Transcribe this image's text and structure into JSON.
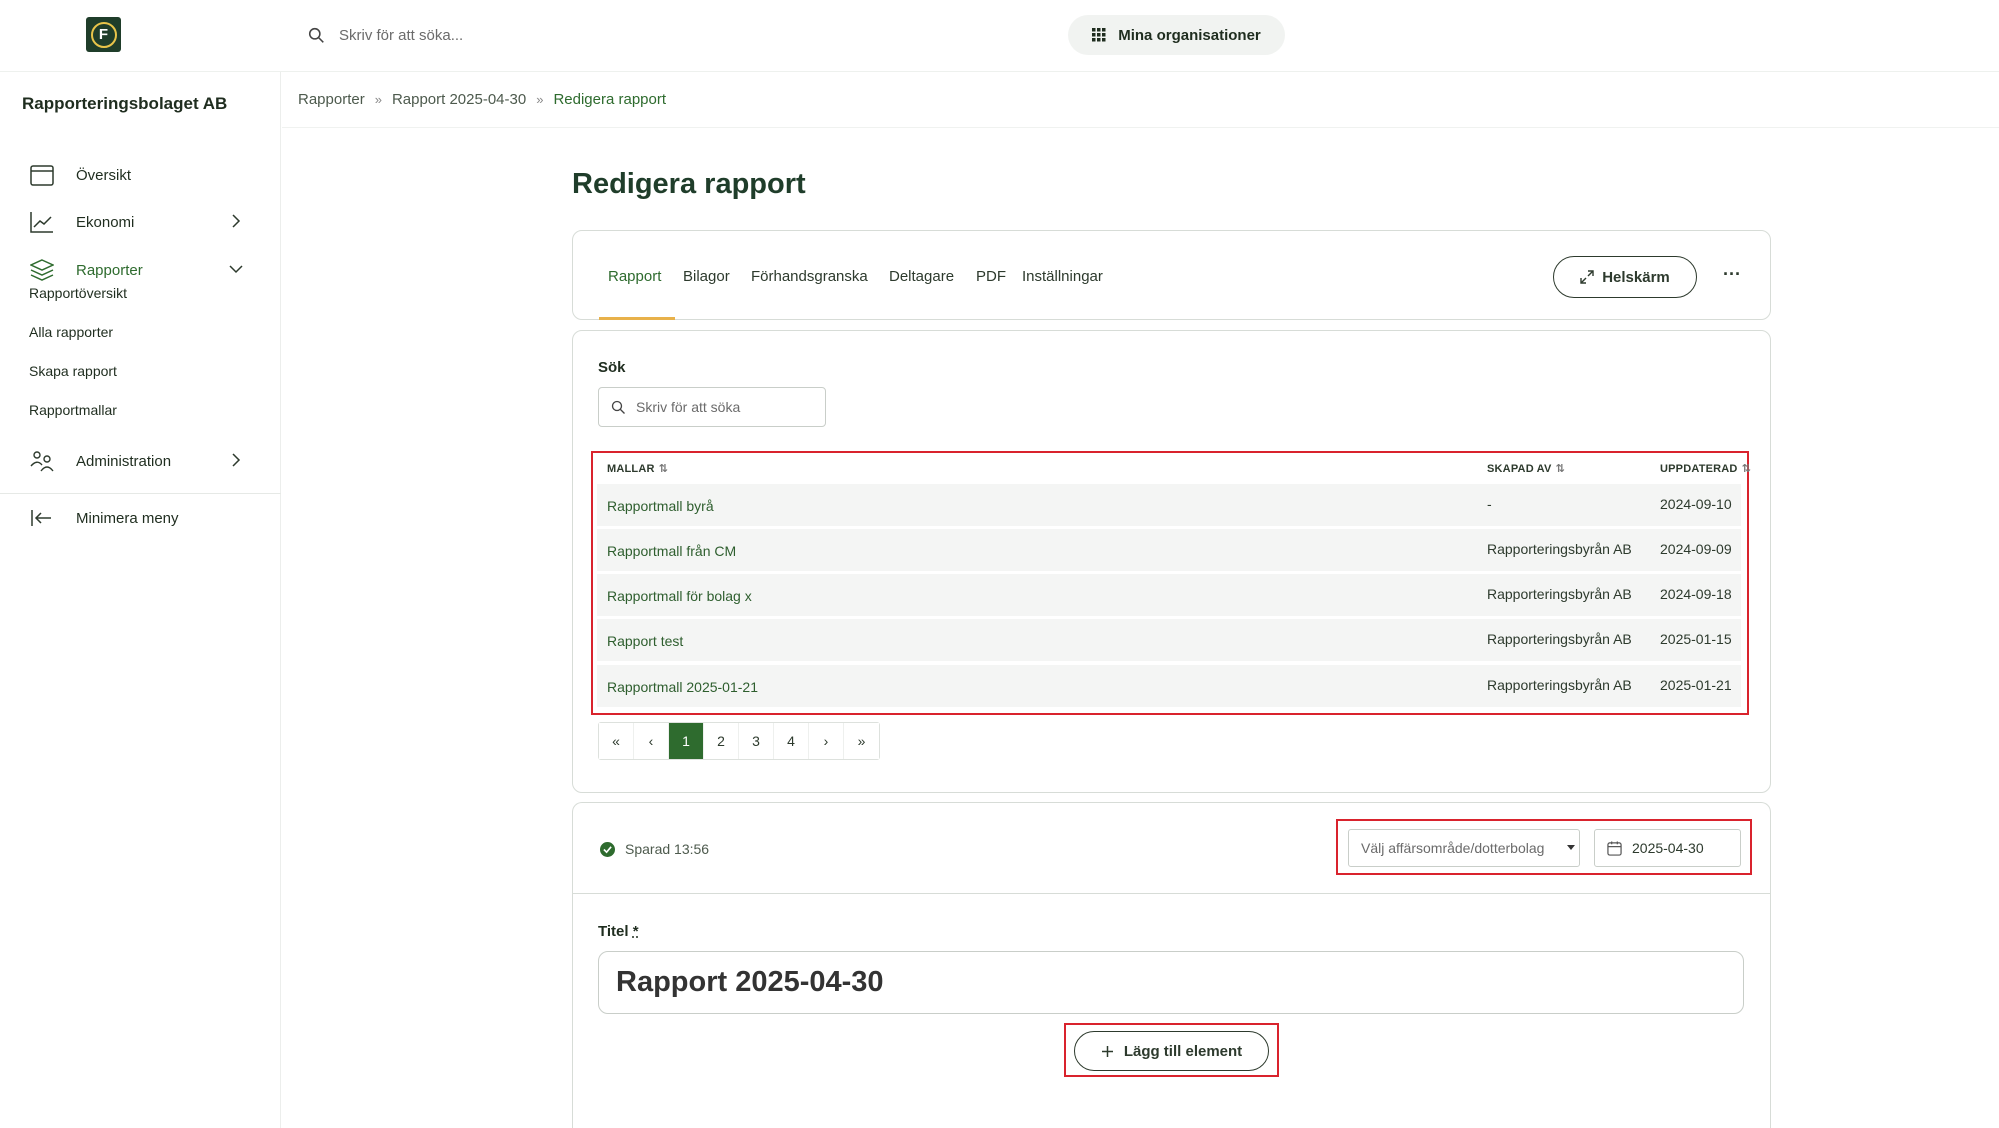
{
  "topbar": {
    "logo_letter": "F",
    "search_placeholder": "Skriv för att söka...",
    "org_button": "Mina organisationer"
  },
  "sidebar": {
    "company": "Rapporteringsbolaget AB",
    "items": [
      {
        "label": "Översikt",
        "icon": "calendar-icon"
      },
      {
        "label": "Ekonomi",
        "icon": "chart-line-icon"
      },
      {
        "label": "Rapporter",
        "icon": "layers-icon"
      },
      {
        "label": "Administration",
        "icon": "users-icon"
      }
    ],
    "sub_items": [
      "Rapportöversikt",
      "Alla rapporter",
      "Skapa rapport",
      "Rapportmallar"
    ],
    "minimize": "Minimera meny"
  },
  "breadcrumb": [
    "Rapporter",
    "Rapport 2025-04-30",
    "Redigera rapport"
  ],
  "page_title": "Redigera rapport",
  "tabs": [
    "Rapport",
    "Bilagor",
    "Förhandsgranska",
    "Deltagare",
    "PDF",
    "Inställningar"
  ],
  "fullscreen_button": "Helskärm",
  "more_button": "···",
  "search": {
    "label": "Sök",
    "placeholder": "Skriv för att söka"
  },
  "table": {
    "headers": [
      "MALLAR",
      "SKAPAD AV",
      "UPPDATERAD"
    ],
    "rows": [
      {
        "name": "Rapportmall byrå",
        "created_by": "-",
        "updated": "2024-09-10"
      },
      {
        "name": "Rapportmall från CM",
        "created_by": "Rapporteringsbyrån AB",
        "updated": "2024-09-09"
      },
      {
        "name": "Rapportmall för bolag x",
        "created_by": "Rapporteringsbyrån AB",
        "updated": "2024-09-18"
      },
      {
        "name": "Rapport test",
        "created_by": "Rapporteringsbyrån AB",
        "updated": "2025-01-15"
      },
      {
        "name": "Rapportmall 2025-01-21",
        "created_by": "Rapporteringsbyrån AB",
        "updated": "2025-01-21"
      }
    ]
  },
  "pagination": {
    "first": "«",
    "prev": "‹",
    "pages": [
      "1",
      "2",
      "3",
      "4"
    ],
    "next": "›",
    "last": "»",
    "current": "1"
  },
  "editor": {
    "saved": "Sparad 13:56",
    "select_placeholder": "Välj affärsområde/dotterbolag",
    "date": "2025-04-30",
    "title_label": "Titel",
    "title_required": "*",
    "title_value": "Rapport 2025-04-30",
    "add_button": "Lägg till element"
  },
  "colors": {
    "accent": "#2e6b2e",
    "tab_underline": "#e8b14a",
    "highlight": "#d9232d"
  }
}
